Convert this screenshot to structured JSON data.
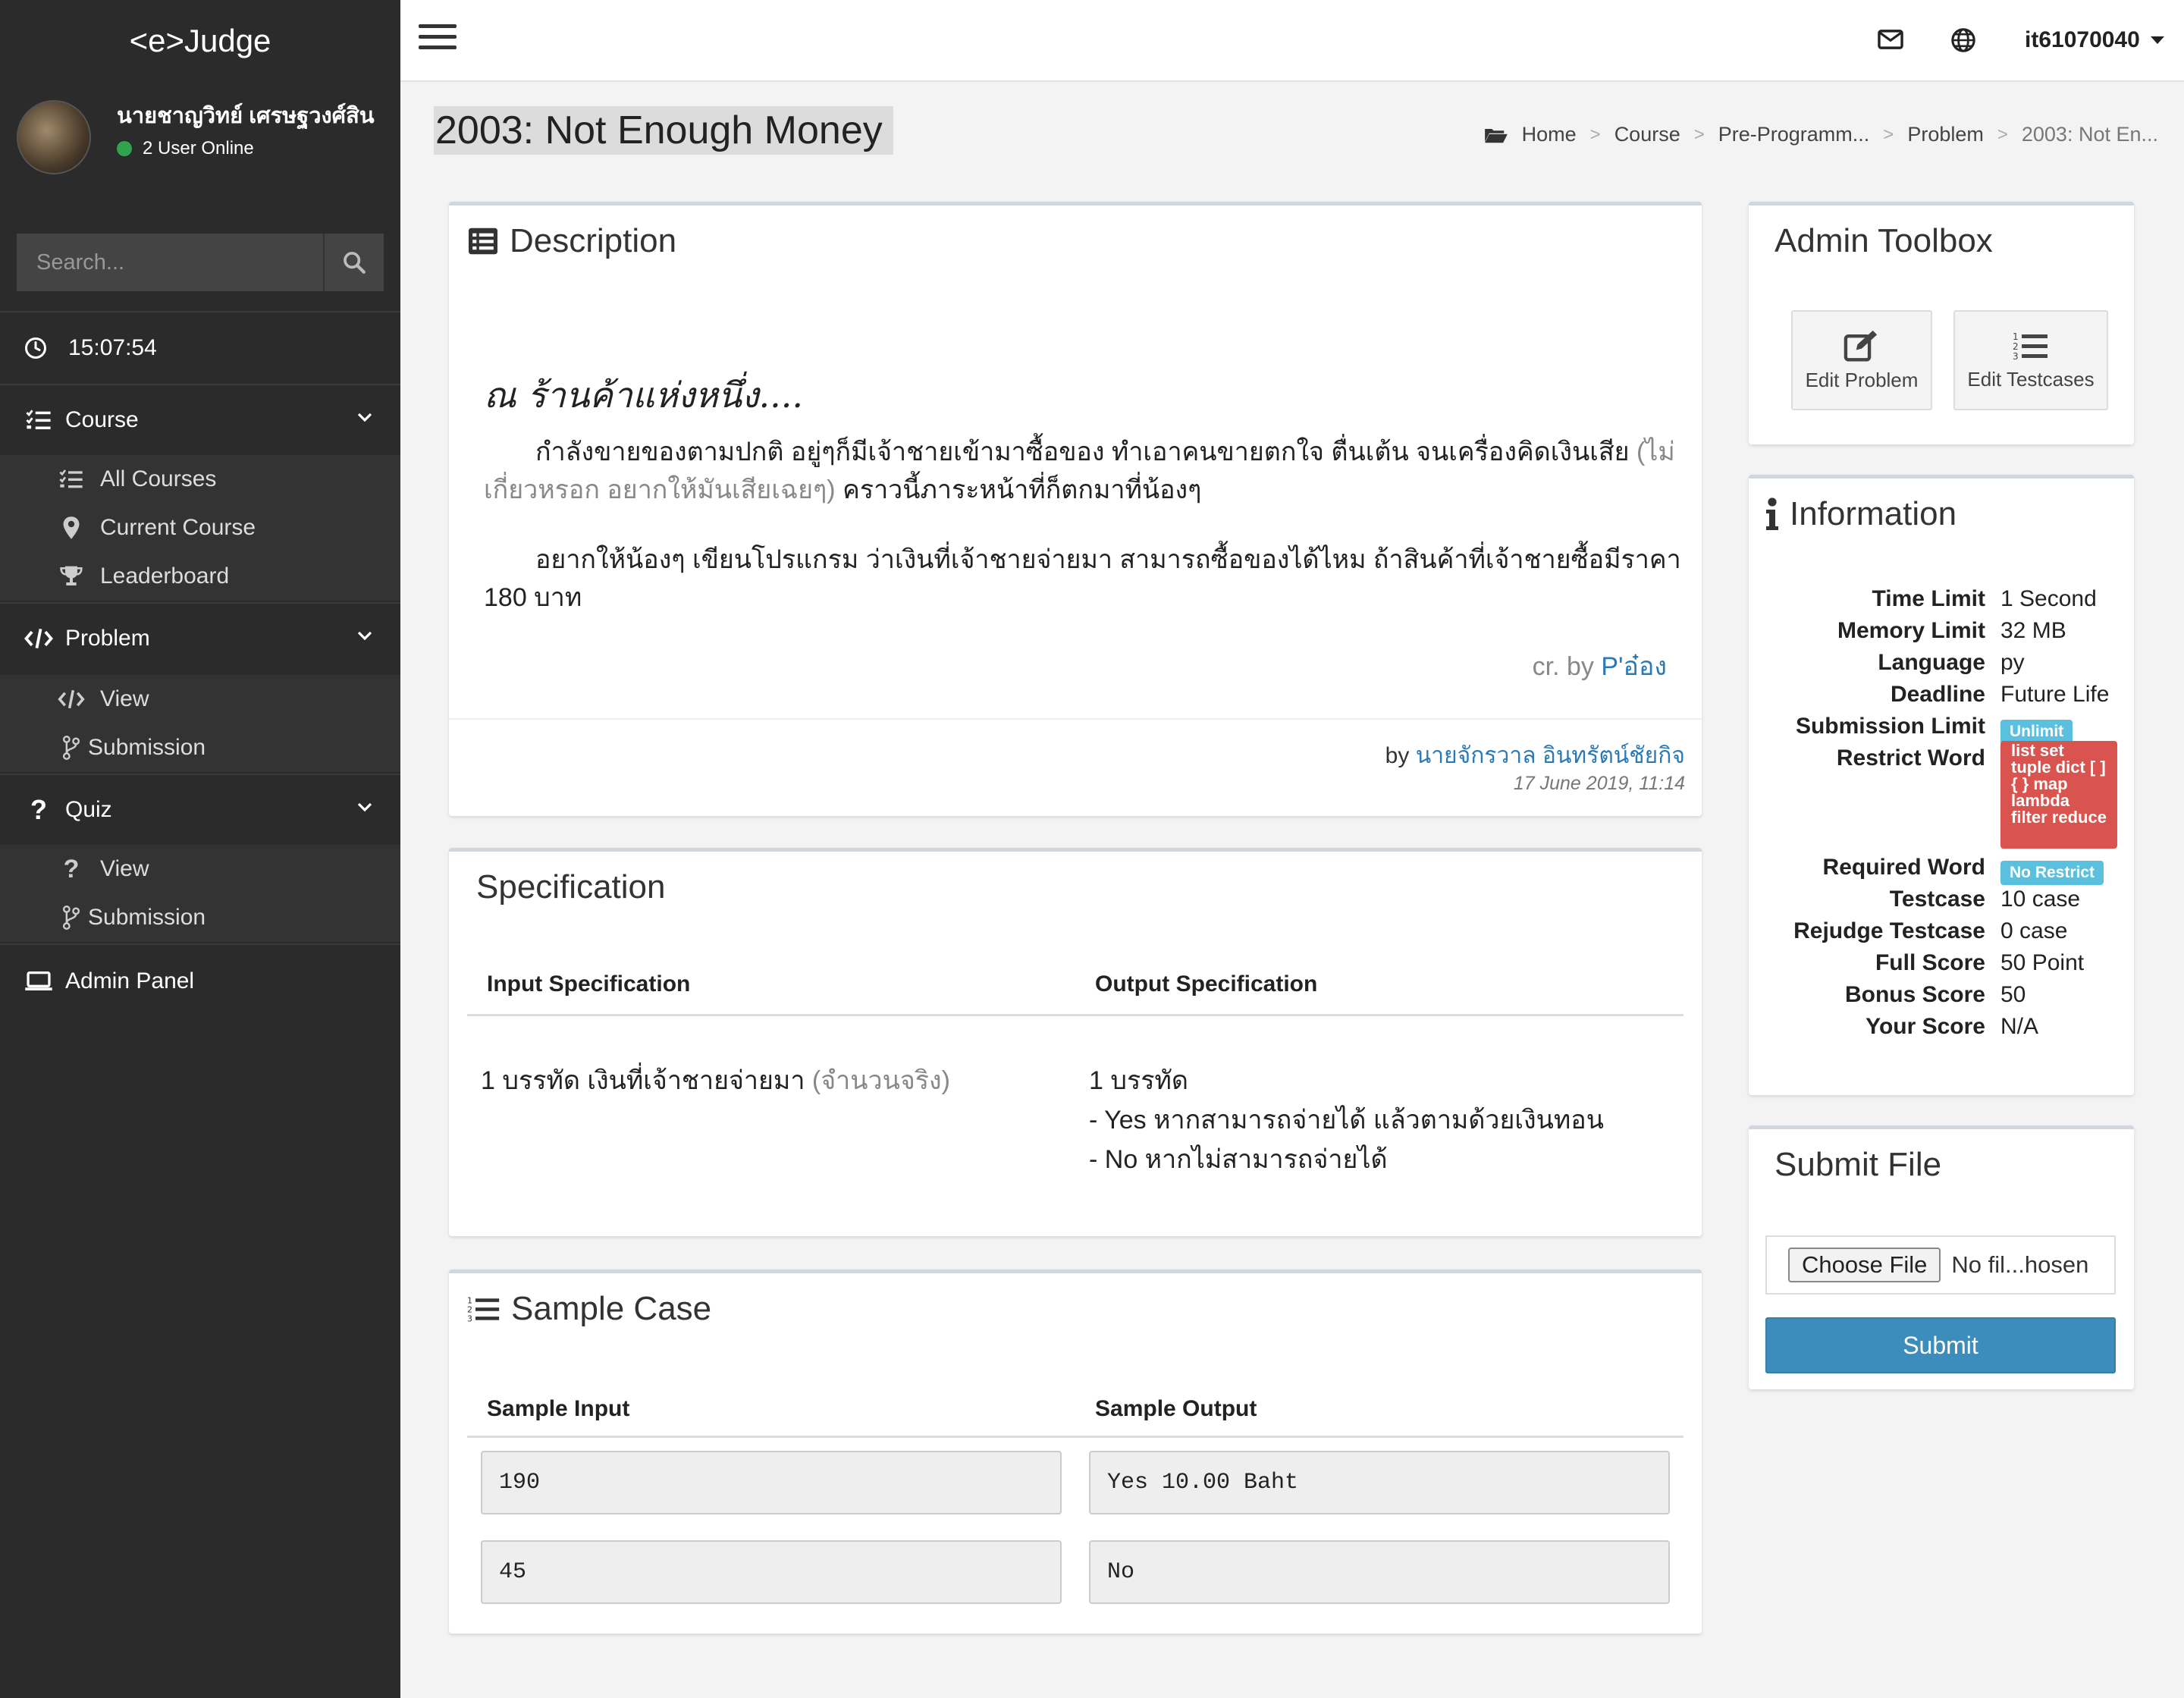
{
  "sidebar": {
    "brand": "<e>Judge",
    "user_name": "นายชาญวิทย์ เศรษฐวงศ์สิน",
    "online_text": "2 User Online",
    "search_placeholder": "Search...",
    "clock": "15:07:54",
    "course": {
      "label": "Course",
      "items": [
        {
          "label": "All Courses",
          "icon": "list-icon"
        },
        {
          "label": "Current Course",
          "icon": "map-marker-icon"
        },
        {
          "label": "Leaderboard",
          "icon": "trophy-icon"
        }
      ]
    },
    "problem": {
      "label": "Problem",
      "items": [
        {
          "label": "View",
          "icon": "code-icon"
        },
        {
          "label": "Submission",
          "icon": "branch-icon"
        }
      ]
    },
    "quiz": {
      "label": "Quiz",
      "items": [
        {
          "label": "View",
          "icon": "question-icon"
        },
        {
          "label": "Submission",
          "icon": "branch-icon"
        }
      ]
    },
    "admin_panel": "Admin Panel"
  },
  "topbar": {
    "username": "it61070040"
  },
  "page": {
    "title": "2003: Not Enough Money",
    "breadcrumb": [
      "Home",
      "Course",
      "Pre-Programm...",
      "Problem",
      "2003: Not En..."
    ]
  },
  "description": {
    "title": "Description",
    "heading": "ณ ร้านค้าแห่งหนึ่ง....",
    "p1_main": "กำลังขายของตามปกติ อยู่ๆก็มีเจ้าชายเข้ามาซื้อของ ทำเอาคนขายตกใจ ตื่นเต้น จนเครื่องคิดเงินเสีย",
    "p1_muted": "(ไม่เกี่ยวหรอก อยากให้มันเสียเฉยๆ)",
    "p1_end": "คราวนี้ภาระหน้าที่ก็ตกมาที่น้องๆ",
    "p2": "อยากให้น้องๆ เขียนโปรแกรม ว่าเงินที่เจ้าชายจ่ายมา สามารถซื้อของได้ไหม ถ้าสินค้าที่เจ้าชายซื้อมีราคา 180 บาท",
    "credit_prefix": "cr. by",
    "credit_name": "P'อ๋อง",
    "by_prefix": "by",
    "author": "นายจักรวาล อินทรัตน์ชัยกิจ",
    "date": "17 June 2019, 11:14"
  },
  "specification": {
    "title": "Specification",
    "input_header": "Input Specification",
    "output_header": "Output Specification",
    "input_main": "1 บรรทัด เงินที่เจ้าชายจ่ายมา",
    "input_muted": "(จำนวนจริง)",
    "output_lines": [
      "1 บรรทัด",
      "- Yes หากสามารถจ่ายได้ แล้วตามด้วยเงินทอน",
      "- No หากไม่สามารถจ่ายได้"
    ]
  },
  "sample": {
    "title": "Sample Case",
    "input_header": "Sample Input",
    "output_header": "Sample Output",
    "rows": [
      {
        "input": "190",
        "output": "Yes 10.00 Baht"
      },
      {
        "input": "45",
        "output": "No"
      }
    ]
  },
  "toolbox": {
    "title": "Admin Toolbox",
    "edit_problem": "Edit Problem",
    "edit_testcases": "Edit Testcases"
  },
  "information": {
    "title": "Information",
    "rows": [
      {
        "key": "Time Limit",
        "value": "1 Second"
      },
      {
        "key": "Memory Limit",
        "value": "32 MB"
      },
      {
        "key": "Language",
        "value": "py"
      },
      {
        "key": "Deadline",
        "value": "Future Life"
      },
      {
        "key": "Submission Limit",
        "value": "Unlimit"
      },
      {
        "key": "Restrict Word",
        "value": "list set tuple dict [ ] { } map lambda filter reduce"
      },
      {
        "key": "Required Word",
        "value": "No Restrict"
      },
      {
        "key": "Testcase",
        "value": "10 case"
      },
      {
        "key": "Rejudge Testcase",
        "value": "0 case"
      },
      {
        "key": "Full Score",
        "value": "50 Point"
      },
      {
        "key": "Bonus Score",
        "value": "50"
      },
      {
        "key": "Your Score",
        "value": "N/A"
      }
    ]
  },
  "submit": {
    "title": "Submit File",
    "choose_label": "Choose File",
    "no_file": "No fil...hosen",
    "button": "Submit"
  },
  "colors": {
    "sidebar_bg": "#2b2b2b",
    "accent": "#3c8dbc",
    "link": "#2a7ab8",
    "badge_info": "#5bc0de",
    "badge_danger": "#d9534f",
    "online": "#2ea44f"
  }
}
